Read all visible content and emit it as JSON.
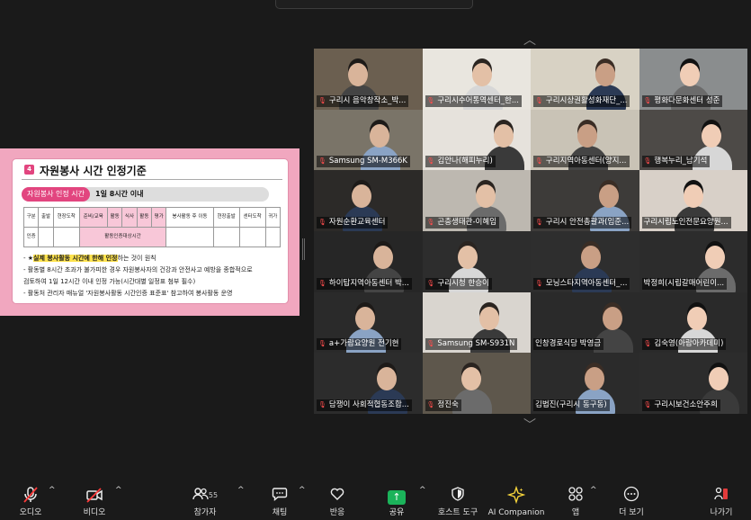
{
  "slide": {
    "number": "4",
    "title": "자원봉사 시간 인정기준",
    "badge": "자원봉사 인정 시간",
    "limit": "1일 8시간 이내",
    "table_headers": [
      "구분",
      "출발",
      "현장도착",
      "준비/교육",
      "활동",
      "식사",
      "활동",
      "평가",
      "봉사활동 후 이동",
      "현장출발",
      "센터도착",
      "귀가"
    ],
    "table_row_label": "인증",
    "table_row_value": "활동인증대상시간",
    "notes": [
      {
        "prefix": "- ★",
        "highlight": "실제 봉사활동 시간에 한해 인정",
        "suffix": "하는 것이 원칙"
      },
      {
        "prefix": "- 활동별 8시간 초과가 불가피한 경우 자원봉사자의 건강과 안전사고 예방을 종합적으로",
        "highlight": "",
        "suffix": ""
      },
      {
        "prefix": "   검토하여 1일 12시간 이내 인정 가능(시간대별 일정표 첨부 필수)",
        "highlight": "",
        "suffix": ""
      },
      {
        "prefix": "- 활동처 관리자 매뉴얼 '자원봉사활동 시간인증 표준표' 참고하여 봉사활동 운영",
        "highlight": "",
        "suffix": ""
      }
    ]
  },
  "participants": [
    {
      "name": "구리시 음악창작소_박...",
      "muted": true,
      "bg": "#6b5f50"
    },
    {
      "name": "구리시수어통역센터_한...",
      "muted": true,
      "bg": "#e9e6df"
    },
    {
      "name": "구리시상권활성화재단_...",
      "muted": true,
      "bg": "#d8d2c4"
    },
    {
      "name": "평화다문화센터 성준",
      "muted": true,
      "bg": "#8a8d8e"
    },
    {
      "name": "Samsung SM-M366K",
      "muted": true,
      "bg": "#7a7468"
    },
    {
      "name": "김안나(해피누리)",
      "muted": true,
      "bg": "#e6e2dc"
    },
    {
      "name": "구리지역아동센터(양지...",
      "muted": true,
      "bg": "#c9c3b6"
    },
    {
      "name": "행복누리_남기석",
      "muted": true,
      "bg": "#4d4a47"
    },
    {
      "name": "자원순환교육센터",
      "muted": true,
      "bg": "#2c2a28"
    },
    {
      "name": "곤충생태관-이혜임",
      "muted": true,
      "bg": "#bdb8b0"
    },
    {
      "name": "구리시 안전총괄과(임준...",
      "muted": true,
      "bg": "#3d3b39"
    },
    {
      "name": "구리시립노인전문요양원...",
      "muted": false,
      "bg": "#d8d0c8"
    },
    {
      "name": "하이탑지역아동센터 박...",
      "muted": true,
      "bg": "#262626"
    },
    {
      "name": "구리시청 한승이",
      "muted": true,
      "bg": "#2d2d2d"
    },
    {
      "name": "모닝스타지역아동센터_...",
      "muted": true,
      "bg": "#2e2e2e"
    },
    {
      "name": "박정희(시립갈매어린이...",
      "muted": false,
      "bg": "#2c2c2c"
    },
    {
      "name": "a+가람요양원 전기현",
      "muted": true,
      "bg": "#2a2a2a"
    },
    {
      "name": "Samsung SM-S931N",
      "muted": true,
      "bg": "#d9d5cf"
    },
    {
      "name": "인창경로식당 박영금",
      "muted": false,
      "bg": "#2a2a2a"
    },
    {
      "name": "김숙영(아람아카데미)",
      "muted": true,
      "bg": "#2a2a2a"
    },
    {
      "name": "담쟁이 사회적협동조합...",
      "muted": true,
      "bg": "#2c2c2c"
    },
    {
      "name": "정진숙",
      "muted": true,
      "bg": "#5e574c"
    },
    {
      "name": "김법진(구리시 동구동)",
      "muted": false,
      "bg": "#2b2b2b"
    },
    {
      "name": "구리시보건소안주희",
      "muted": true,
      "bg": "#2c2c2c"
    }
  ],
  "toolbar": {
    "audio": "오디오",
    "video": "비디오",
    "participants": "참가자",
    "participants_count": "55",
    "chat": "채팅",
    "reactions": "반응",
    "share": "공유",
    "host_tools": "호스트 도구",
    "ai": "AI Companion",
    "apps": "앱",
    "more": "더 보기",
    "leave": "나가기"
  }
}
